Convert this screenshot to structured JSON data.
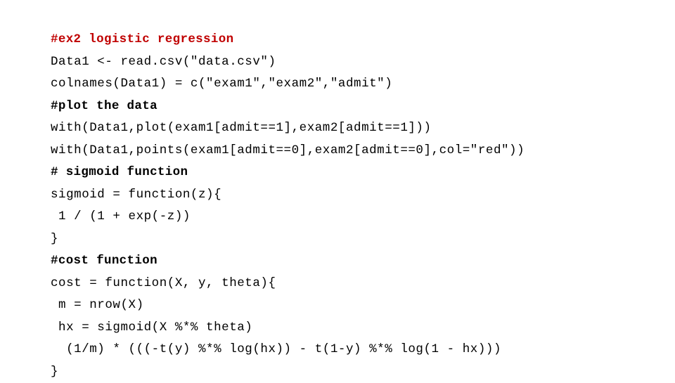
{
  "slide": {
    "background_color": "#ffffff",
    "text_color": "#000000",
    "accent_color": "#c00000",
    "language": "R",
    "lines": [
      {
        "text": "#ex2 logistic regression",
        "style": "heading accent",
        "name": "code-line-comment-ex2"
      },
      {
        "text": "Data1 <- read.csv(\"data.csv\")",
        "style": "",
        "name": "code-line-read-csv"
      },
      {
        "text": "colnames(Data1) = c(\"exam1\",\"exam2\",\"admit\")",
        "style": "",
        "name": "code-line-colnames"
      },
      {
        "text": "#plot the data",
        "style": "heading",
        "name": "code-line-comment-plot"
      },
      {
        "text": "with(Data1,plot(exam1[admit==1],exam2[admit==1]))",
        "style": "",
        "name": "code-line-plot-admit1"
      },
      {
        "text": "with(Data1,points(exam1[admit==0],exam2[admit==0],col=\"red\"))",
        "style": "",
        "name": "code-line-points-admit0"
      },
      {
        "text": "# sigmoid function",
        "style": "heading",
        "name": "code-line-comment-sigmoid"
      },
      {
        "text": "sigmoid = function(z){",
        "style": "",
        "name": "code-line-sigmoid-def"
      },
      {
        "text": " 1 / (1 + exp(-z))",
        "style": "",
        "name": "code-line-sigmoid-body"
      },
      {
        "text": "}",
        "style": "",
        "name": "code-line-sigmoid-close"
      },
      {
        "text": "#cost function",
        "style": "heading",
        "name": "code-line-comment-cost"
      },
      {
        "text": "cost = function(X, y, theta){",
        "style": "",
        "name": "code-line-cost-def"
      },
      {
        "text": " m = nrow(X)",
        "style": "",
        "name": "code-line-cost-m"
      },
      {
        "text": " hx = sigmoid(X %*% theta)",
        "style": "",
        "name": "code-line-cost-hx"
      },
      {
        "text": "  (1/m) * (((-t(y) %*% log(hx)) - t(1-y) %*% log(1 - hx)))",
        "style": "",
        "name": "code-line-cost-expr"
      },
      {
        "text": "}",
        "style": "",
        "name": "code-line-cost-close"
      }
    ]
  }
}
